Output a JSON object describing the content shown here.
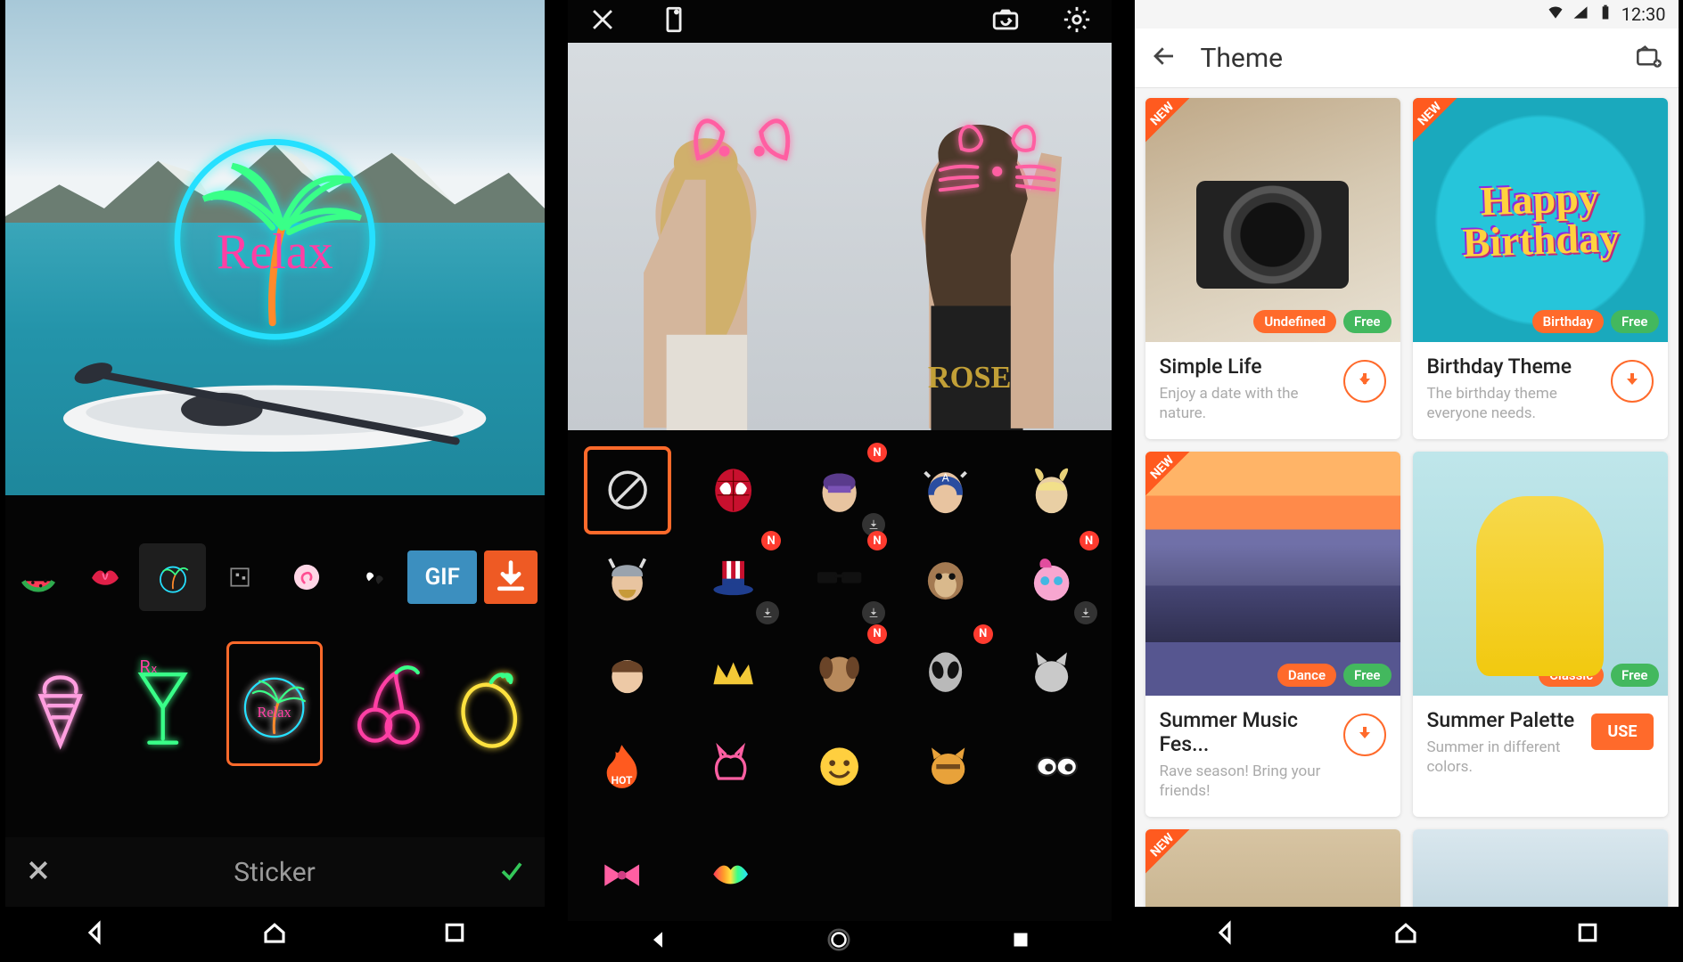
{
  "panel1": {
    "preview_sticker_text": "Relax",
    "packs": {
      "gif_label": "GIF"
    },
    "footer": {
      "label": "Sticker"
    }
  },
  "panel2": {
    "new_badge": "N",
    "hot_label": "HOT"
  },
  "panel3": {
    "status": {
      "time": "12:30"
    },
    "appbar": {
      "title": "Theme"
    },
    "badge_new": "NEW",
    "chip_free": "Free",
    "cards": [
      {
        "chip": "Undefined",
        "title": "Simple Life",
        "sub": "Enjoy a date with the nature.",
        "action": "download"
      },
      {
        "chip": "Birthday",
        "title": "Birthday Theme",
        "sub": "The birthday theme everyone needs.",
        "action": "download"
      },
      {
        "chip": "Dance",
        "title": "Summer Music Fes...",
        "sub": "Rave season! Bring your friends!",
        "action": "download"
      },
      {
        "chip": "Classic",
        "title": "Summer Palette",
        "sub": "Summer in different colors.",
        "action": "use"
      }
    ],
    "use_label": "USE",
    "bday_text": "Happy Birthday"
  }
}
